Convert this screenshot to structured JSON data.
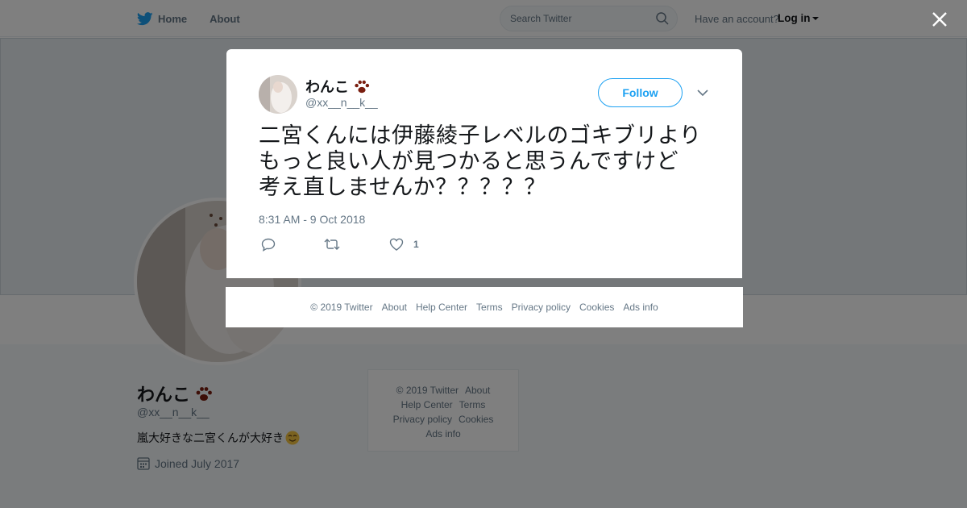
{
  "topnav": {
    "home_label": "Home",
    "about_label": "About",
    "search_placeholder": "Search Twitter",
    "have_account": "Have an account?",
    "login_label": "Log in"
  },
  "profile": {
    "name": "わんこ",
    "handle": "@xx__n__k__",
    "bio": "嵐大好きな二宮くんが大好き",
    "joined": "Joined July 2017"
  },
  "side_footer": {
    "copyright": "© 2019 Twitter",
    "about": "About",
    "help_center": "Help Center",
    "terms": "Terms",
    "privacy": "Privacy policy",
    "cookies": "Cookies",
    "ads_info": "Ads info"
  },
  "modal": {
    "name": "わんこ",
    "handle": "@xx__n__k__",
    "follow_label": "Follow",
    "tweet_line1": "二宮くんには伊藤綾子レベルのゴキブリより",
    "tweet_line2": "もっと良い人が見つかると思うんですけど",
    "tweet_line3": "考え直しませんか？？？？？",
    "timestamp": "8:31 AM - 9 Oct 2018",
    "like_count": "1"
  },
  "modal_footer": {
    "copyright": "© 2019 Twitter",
    "about": "About",
    "help_center": "Help Center",
    "terms": "Terms",
    "privacy": "Privacy policy",
    "cookies": "Cookies",
    "ads_info": "Ads info"
  },
  "colors": {
    "brand": "#1da1f2",
    "text_secondary": "#657786",
    "overlay": "rgba(0,0,0,0.5)"
  },
  "icons": [
    "twitter-bird-icon",
    "search-icon",
    "close-icon",
    "chevron-down-icon",
    "reply-icon",
    "retweet-icon",
    "heart-icon",
    "calendar-icon",
    "paw-icon"
  ]
}
